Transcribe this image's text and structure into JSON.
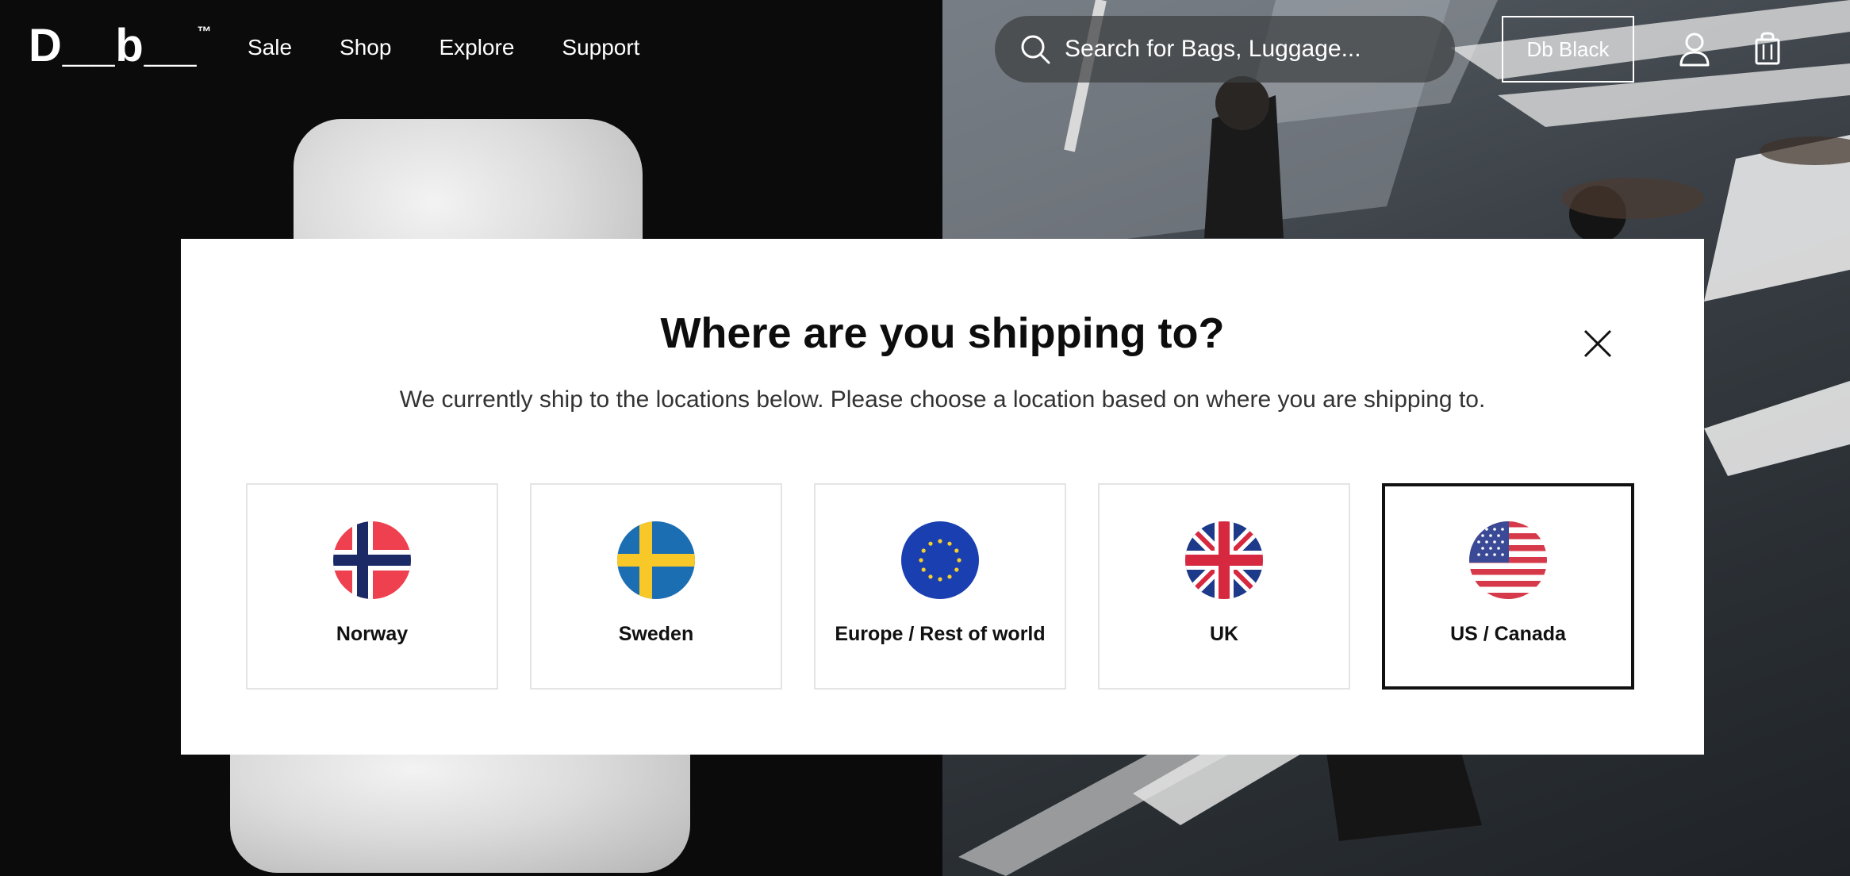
{
  "header": {
    "logo": "D__b__",
    "logo_mark": "™",
    "nav": [
      {
        "label": "Sale"
      },
      {
        "label": "Shop"
      },
      {
        "label": "Explore"
      },
      {
        "label": "Support"
      }
    ],
    "search": {
      "placeholder": "Search for Bags, Luggage..."
    },
    "db_black_label": "Db Black",
    "icons": [
      "search-icon",
      "user-icon",
      "cart-icon"
    ]
  },
  "modal": {
    "title": "Where are you shipping to?",
    "subtitle": "We currently ship to the locations below. Please choose a location based on where you are shipping to.",
    "close_icon": "close-icon",
    "regions": [
      {
        "label": "Norway",
        "icon": "norway-flag-icon",
        "selected": false
      },
      {
        "label": "Sweden",
        "icon": "sweden-flag-icon",
        "selected": false
      },
      {
        "label": "Europe / Rest of world",
        "icon": "eu-flag-icon",
        "selected": false
      },
      {
        "label": "UK",
        "icon": "uk-flag-icon",
        "selected": false
      },
      {
        "label": "US / Canada",
        "icon": "us-flag-icon",
        "selected": true
      }
    ]
  },
  "colors": {
    "modal_bg": "#ffffff",
    "selected_border": "#111111",
    "card_border": "#e4e4e4",
    "page_left_bg": "#0b0b0b"
  }
}
